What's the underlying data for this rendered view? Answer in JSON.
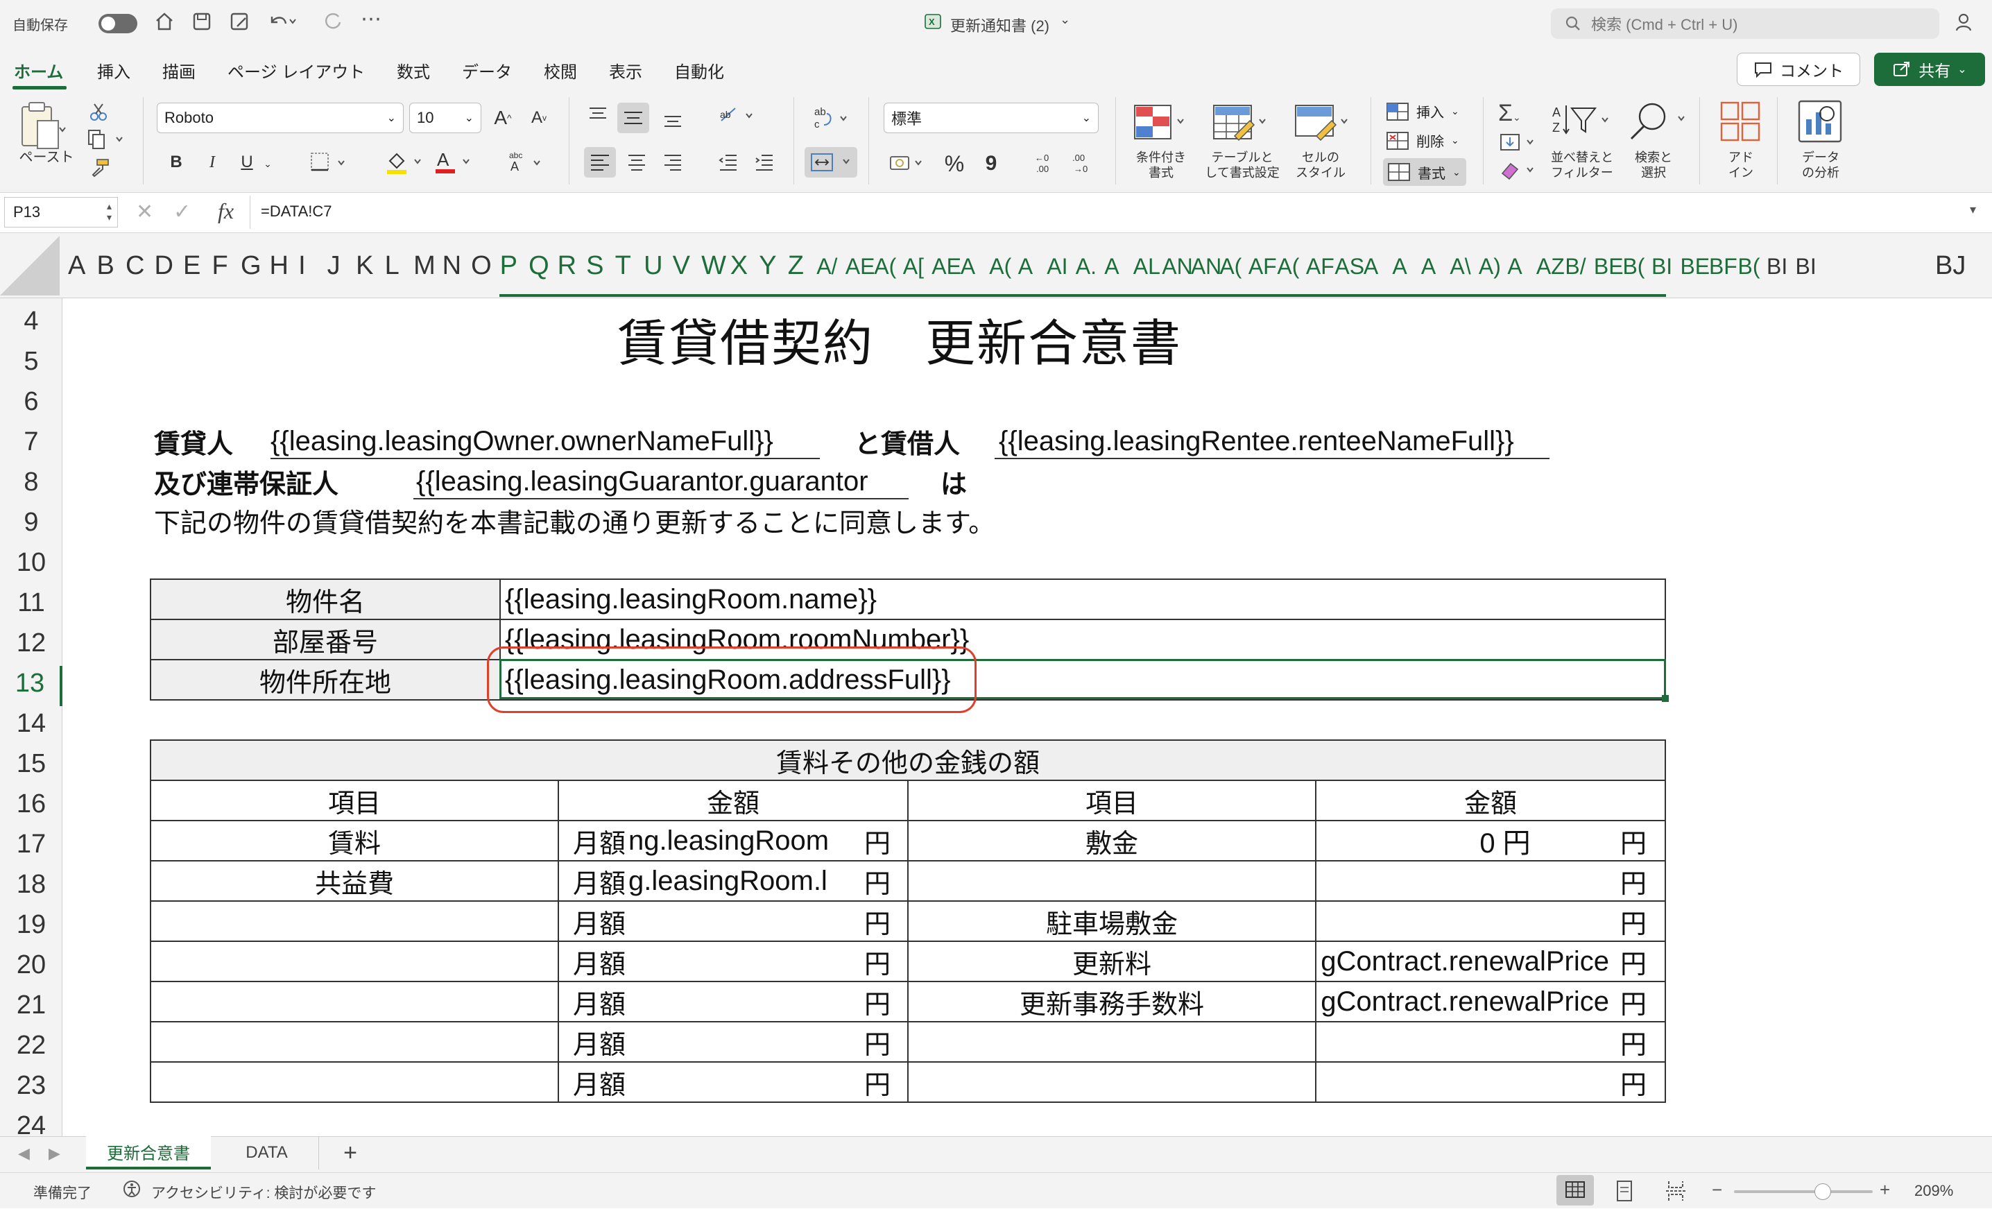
{
  "titlebar": {
    "autosave_label": "自動保存",
    "file_name": "更新通知書 (2)",
    "search_placeholder": "検索 (Cmd + Ctrl + U)"
  },
  "menu": {
    "tabs": [
      "ホーム",
      "挿入",
      "描画",
      "ページ レイアウト",
      "数式",
      "データ",
      "校閲",
      "表示",
      "自動化"
    ],
    "active": "ホーム",
    "comment_button": "コメント",
    "share_button": "共有"
  },
  "ribbon": {
    "paste_label": "ペースト",
    "font_name": "Roboto",
    "font_size": "10",
    "number_format": "標準",
    "percent": "%",
    "comma": "9",
    "conditional_format": [
      "条件付き",
      "書式"
    ],
    "table_format": [
      "テーブルと",
      "して書式設定"
    ],
    "cell_style": [
      "セルの",
      "スタイル"
    ],
    "insert": "挿入",
    "delete": "削除",
    "format": "書式",
    "sort_filter": [
      "並べ替えと",
      "フィルター"
    ],
    "find_select": [
      "検索と",
      "選択"
    ],
    "addin": [
      "アド",
      "イン"
    ],
    "analyze": [
      "データ",
      "の分析"
    ],
    "bold": "B",
    "italic": "I",
    "underline": "U"
  },
  "formula_bar": {
    "cell_ref": "P13",
    "fx": "fx",
    "formula": "=DATA!C7"
  },
  "columns": {
    "letters": [
      "A",
      "B",
      "C",
      "D",
      "E",
      "F",
      "G",
      "H",
      "I",
      "J",
      "K",
      "L",
      "M",
      "N",
      "O",
      "P",
      "Q",
      "R",
      "S",
      "T",
      "U",
      "V",
      "W",
      "X",
      "Y",
      "Z",
      "A/",
      "AE",
      "A(",
      "A[",
      "AE",
      "A",
      "A(",
      "A",
      "AI",
      "A.",
      "A",
      "AL",
      "AN",
      "AN",
      "A(",
      "AF",
      "A(",
      "AF",
      "AS",
      "A",
      "A",
      "A",
      "A\\",
      "A)",
      "A",
      "AZ",
      "B/",
      "BE",
      "B(",
      "BI",
      "BE",
      "BF",
      "B(",
      "BI",
      "BI",
      "BJ"
    ],
    "last": "BJ"
  },
  "rows": [
    "4",
    "5",
    "6",
    "7",
    "8",
    "9",
    "10",
    "11",
    "12",
    "13",
    "14",
    "15",
    "16",
    "17",
    "18",
    "19",
    "20",
    "21",
    "22",
    "23",
    "24"
  ],
  "sheet": {
    "title": "賃貸借契約　更新合意書",
    "row7_lessor_label": "賃貸人",
    "row7_lessor_value": "{{leasing.leasingOwner.ownerNameFull}}",
    "row7_lessee_label": "と賃借人",
    "row7_lessee_value": "{{leasing.leasingRentee.renteeNameFull}}",
    "row8_guarantor_label": "及び連帯保証人",
    "row8_guarantor_value": "{{leasing.leasingGuarantor.guarantor",
    "row8_wa": "は",
    "row9_text": "下記の物件の賃貸借契約を本書記載の通り更新することに同意します。",
    "property_table": [
      {
        "label": "物件名",
        "value": "{{leasing.leasingRoom.name}}"
      },
      {
        "label": "部屋番号",
        "value": "{{leasing.leasingRoom.roomNumber}}"
      },
      {
        "label": "物件所在地",
        "value": "{{leasing.leasingRoom.addressFull}}"
      }
    ],
    "money_table": {
      "title": "賃料その他の金銭の額",
      "headers": [
        "項目",
        "金額",
        "項目",
        "金額"
      ],
      "monthly": "月額",
      "yen": "円",
      "rows": [
        {
          "left_item": "賃料",
          "left_value": "ng.leasingRoom",
          "right_item": "敷金",
          "right_value": "0 円"
        },
        {
          "left_item": "共益費",
          "left_value": "g.leasingRoom.l",
          "right_item": "",
          "right_value": ""
        },
        {
          "left_item": "",
          "left_value": "",
          "right_item": "駐車場敷金",
          "right_value": ""
        },
        {
          "left_item": "",
          "left_value": "",
          "right_item": "更新料",
          "right_value": "gContract.renewalPrice"
        },
        {
          "left_item": "",
          "left_value": "",
          "right_item": "更新事務手数料",
          "right_value": "gContract.renewalPrice"
        },
        {
          "left_item": "",
          "left_value": "",
          "right_item": "",
          "right_value": ""
        },
        {
          "left_item": "",
          "left_value": "",
          "right_item": "",
          "right_value": ""
        }
      ]
    }
  },
  "sheet_tabs": [
    "更新合意書",
    "DATA"
  ],
  "active_sheet": "更新合意書",
  "add_sheet": "+",
  "status": {
    "ready": "準備完了",
    "accessibility": "アクセシビリティ: 検討が必要です",
    "zoom": "209%"
  },
  "colors": {
    "accent": "#1d6d3a",
    "highlight_circle": "#e0402a"
  }
}
